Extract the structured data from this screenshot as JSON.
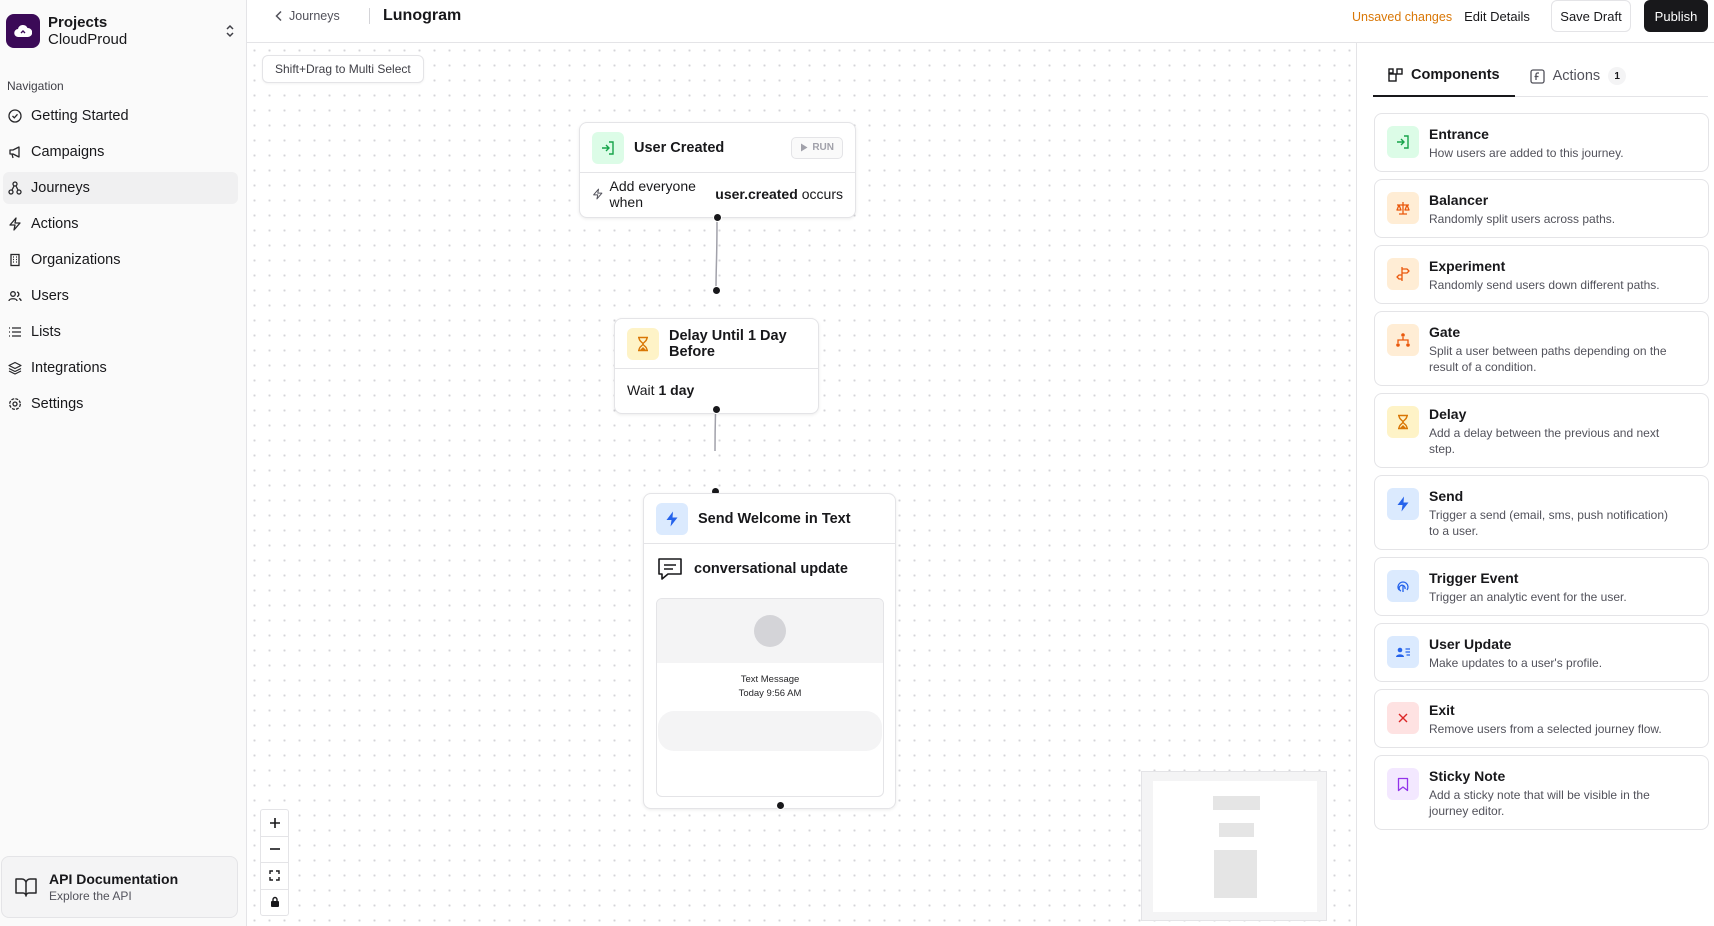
{
  "project": {
    "label": "Projects",
    "name": "CloudProud"
  },
  "nav": {
    "heading": "Navigation",
    "items": [
      {
        "label": "Getting Started",
        "icon": "check-circle-icon"
      },
      {
        "label": "Campaigns",
        "icon": "megaphone-icon"
      },
      {
        "label": "Journeys",
        "icon": "journey-icon",
        "active": true
      },
      {
        "label": "Actions",
        "icon": "bolt-icon"
      },
      {
        "label": "Organizations",
        "icon": "building-icon"
      },
      {
        "label": "Users",
        "icon": "users-icon"
      },
      {
        "label": "Lists",
        "icon": "list-icon"
      },
      {
        "label": "Integrations",
        "icon": "layers-icon"
      },
      {
        "label": "Settings",
        "icon": "gear-icon"
      }
    ]
  },
  "api": {
    "title": "API Documentation",
    "subtitle": "Explore the API"
  },
  "header": {
    "back": "Journeys",
    "title": "Lunogram",
    "unsaved": "Unsaved changes",
    "edit": "Edit Details",
    "save": "Save Draft",
    "publish": "Publish"
  },
  "canvas": {
    "multi_select_hint": "Shift+Drag to Multi Select",
    "entrance_node": {
      "title": "User Created",
      "run": "RUN",
      "body_pre": "Add everyone when",
      "body_bold": "user.created",
      "body_post": "occurs"
    },
    "delay_node": {
      "title": "Delay Until 1 Day Before",
      "body_pre": "Wait",
      "body_bold": "1 day"
    },
    "send_node": {
      "title": "Send Welcome in Text",
      "template": "conversational update",
      "preview_kind": "Text Message",
      "preview_time": "Today 9:56 AM"
    }
  },
  "panel": {
    "tabs": [
      {
        "label": "Components",
        "active": true
      },
      {
        "label": "Actions",
        "count": "1"
      }
    ],
    "components": [
      {
        "title": "Entrance",
        "desc": "How users are added to this journey.",
        "icon": "entrance-icon",
        "color": "#16a34a",
        "bg": "#dcfce7"
      },
      {
        "title": "Balancer",
        "desc": "Randomly split users across paths.",
        "icon": "scale-icon",
        "color": "#ea580c",
        "bg": "#ffedd5"
      },
      {
        "title": "Experiment",
        "desc": "Randomly send users down different paths.",
        "icon": "signpost-icon",
        "color": "#ea580c",
        "bg": "#ffedd5"
      },
      {
        "title": "Gate",
        "desc": "Split a user between paths depending on the result of a condition.",
        "icon": "split-icon",
        "color": "#ea580c",
        "bg": "#ffedd5"
      },
      {
        "title": "Delay",
        "desc": "Add a delay between the previous and next step.",
        "icon": "hourglass-icon",
        "color": "#d97706",
        "bg": "#fef3c7"
      },
      {
        "title": "Send",
        "desc": "Trigger a send (email, sms, push notification) to a user.",
        "icon": "bolt-icon",
        "color": "#2563eb",
        "bg": "#dbeafe"
      },
      {
        "title": "Trigger Event",
        "desc": "Trigger an analytic event for the user.",
        "icon": "fingerprint-icon",
        "color": "#2563eb",
        "bg": "#dbeafe"
      },
      {
        "title": "User Update",
        "desc": "Make updates to a user's profile.",
        "icon": "user-card-icon",
        "color": "#2563eb",
        "bg": "#dbeafe"
      },
      {
        "title": "Exit",
        "desc": "Remove users from a selected journey flow.",
        "icon": "x-icon",
        "color": "#dc2626",
        "bg": "#fee2e2"
      },
      {
        "title": "Sticky Note",
        "desc": "Add a sticky note that will be visible in the journey editor.",
        "icon": "bookmark-icon",
        "color": "#9333ea",
        "bg": "#f3e8ff"
      }
    ]
  }
}
